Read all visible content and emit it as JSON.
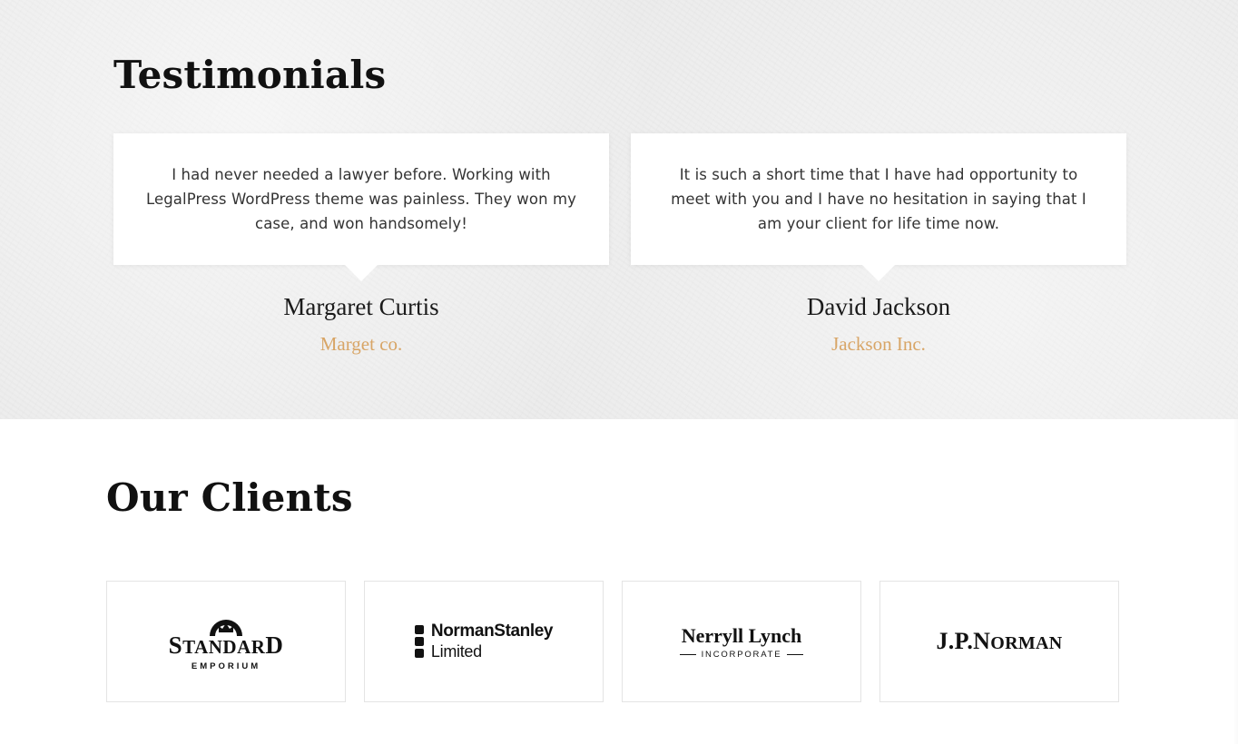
{
  "testimonials": {
    "title": "Testimonials",
    "items": [
      {
        "quote": "I had never needed a lawyer before. Working with LegalPress WordPress theme was painless. They won my case, and won handsomely!",
        "author": "Margaret Curtis",
        "company": "Marget co."
      },
      {
        "quote": "It is such a short time that I have had opportunity to meet with you and I have no hesitation in saying that I am your client for life time now.",
        "author": "David Jackson",
        "company": "Jackson Inc."
      }
    ]
  },
  "clients": {
    "title": "Our Clients",
    "logos": [
      {
        "name_first": "S",
        "name_rest": "TANDAR",
        "name_last": "D",
        "sub": "EMPORIUM",
        "icon": "crown-crest-icon"
      },
      {
        "line1": "NormanStanley",
        "line2": "Limited",
        "icon": "three-dots-mark-icon"
      },
      {
        "name": "Nerryll Lynch",
        "sub": "INCORPORATE"
      },
      {
        "prefix": "J.P.N",
        "rest": "ORMAN"
      }
    ]
  },
  "colors": {
    "accent": "#d8a566",
    "text": "#111111",
    "testimonial_bg": "#ececec",
    "card_bg": "#ffffff"
  }
}
